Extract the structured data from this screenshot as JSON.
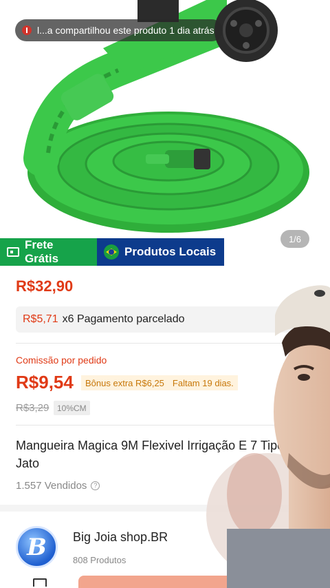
{
  "share_banner": {
    "text": "l...a compartilhou este produto 1 dia atrás"
  },
  "image_pager": "1/6",
  "badges": {
    "shipping": "Frete Grátis",
    "local": "Produtos Locais"
  },
  "price": "R$32,90",
  "installment": {
    "amount": "R$5,71",
    "text": "x6 Pagamento parcelado"
  },
  "commission": {
    "label": "Comissão por pedido",
    "value": "R$9,54",
    "bonus": "Bônus extra R$6,25",
    "remaining": "Faltam 19 dias.",
    "old_value": "R$3,29",
    "rate_tag": "10%CM"
  },
  "product": {
    "title": "Mangueira Magica 9M Flexivel Irrigação E 7 Tipos De Jato",
    "sold": "1.557 Vendidos"
  },
  "shop": {
    "name": "Big Joia shop.BR",
    "products": "808 Produtos",
    "logo_letter": "B"
  },
  "colors": {
    "accent": "#e03a16",
    "shipping_badge": "#16a34a",
    "local_badge": "#0d3b8c",
    "hose": "#3cc84a"
  }
}
